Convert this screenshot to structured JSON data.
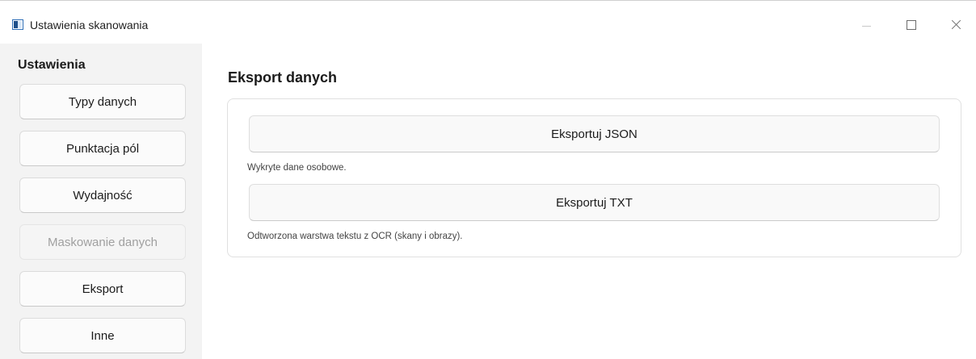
{
  "window": {
    "title": "Ustawienia skanowania",
    "controls": [
      "minimize",
      "maximize",
      "close"
    ]
  },
  "sidebar": {
    "heading": "Ustawienia",
    "items": [
      {
        "label": "Typy danych",
        "enabled": true
      },
      {
        "label": "Punktacja pól",
        "enabled": true
      },
      {
        "label": "Wydajność",
        "enabled": true
      },
      {
        "label": "Maskowanie danych",
        "enabled": false
      },
      {
        "label": "Eksport",
        "enabled": true
      },
      {
        "label": "Inne",
        "enabled": true
      }
    ]
  },
  "main": {
    "title": "Eksport danych",
    "exports": [
      {
        "button_label": "Eksportuj JSON",
        "description": "Wykryte dane osobowe."
      },
      {
        "button_label": "Eksportuj TXT",
        "description": "Odtworzona warstwa tekstu z OCR (skany i obrazy)."
      }
    ]
  }
}
